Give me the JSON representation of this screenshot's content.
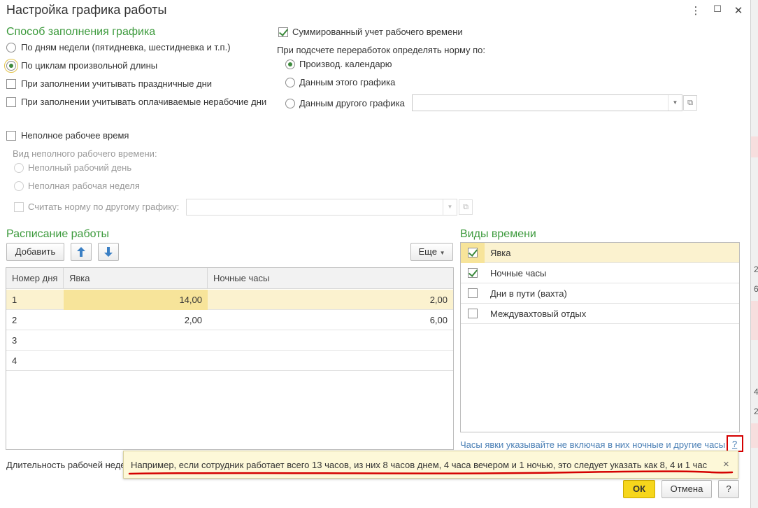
{
  "window": {
    "title": "Настройка графика работы",
    "menu_icon": "⋮",
    "maximize_icon": "☐",
    "close_icon": "✕"
  },
  "fill_method": {
    "heading": "Способ заполнения графика",
    "option_weekdays": "По дням недели (пятидневка, шестидневка и т.п.)",
    "option_cycles": "По циклам произвольной длины",
    "selected": "По циклам произвольной длины",
    "chk_holidays": "При заполнении учитывать праздничные дни",
    "chk_paid_nonworking": "При заполнении учитывать оплачиваемые нерабочие дни"
  },
  "summarized": {
    "checkbox": "Суммированный учет рабочего времени",
    "checked": true,
    "norm_label": "При подсчете переработок определять норму по:",
    "option_calendar": "Производ. календарю",
    "option_this": "Данным этого графика",
    "option_other": "Данным другого графика",
    "other_value": ""
  },
  "part_time": {
    "checkbox": "Неполное рабочее время",
    "kind_label": "Вид неполного рабочего времени:",
    "option_day": "Неполный рабочий день",
    "option_week": "Неполная рабочая неделя",
    "norm_checkbox": "Считать норму по другому графику:",
    "norm_value": ""
  },
  "schedule": {
    "heading": "Расписание работы",
    "add_button": "Добавить",
    "more_button": "Еще",
    "columns": [
      "Номер дня",
      "Явка",
      "Ночные часы"
    ],
    "rows": [
      {
        "day": "1",
        "presence": "14,00",
        "night": "2,00"
      },
      {
        "day": "2",
        "presence": "2,00",
        "night": "6,00"
      },
      {
        "day": "3",
        "presence": "",
        "night": ""
      },
      {
        "day": "4",
        "presence": "",
        "night": ""
      }
    ]
  },
  "time_types": {
    "heading": "Виды времени",
    "items": [
      {
        "label": "Явка",
        "checked": true
      },
      {
        "label": "Ночные часы",
        "checked": true
      },
      {
        "label": "Дни в пути (вахта)",
        "checked": false
      },
      {
        "label": "Междувахтовый отдых",
        "checked": false
      }
    ],
    "hint_link": "Часы явки указывайте не включая в них ночные и другие часы",
    "help_icon": "?"
  },
  "footer": {
    "duration_label": "Длительность рабочей неде",
    "ok": "ОК",
    "cancel": "Отмена",
    "help": "?"
  },
  "tooltip": {
    "text": "Например, если сотрудник работает всего 13 часов, из них 8 часов днем, 4 часа вечером и 1 ночью, это следует указать как 8, 4 и 1 час",
    "close": "×"
  },
  "background_digits": [
    "2",
    "6",
    "4",
    "2"
  ],
  "colors": {
    "accent_green": "#3c9a3c",
    "selected_row": "#fbf2cf",
    "selected_cell": "#f7e49a",
    "ok_button": "#f6d61c",
    "link": "#4a7fb5",
    "highlight_red": "#d40000"
  }
}
